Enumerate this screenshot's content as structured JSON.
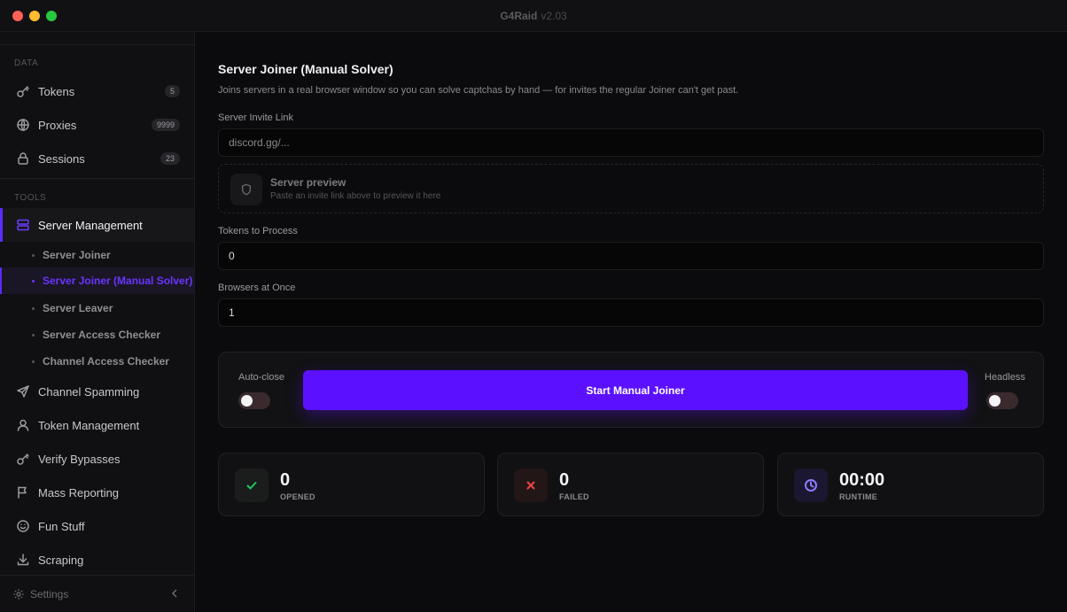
{
  "app": {
    "title": "G4Raid",
    "version": "v2.03"
  },
  "sidebar": {
    "sections": {
      "data": "DATA",
      "tools": "TOOLS"
    },
    "data_items": [
      {
        "label": "Tokens",
        "badge": "5",
        "icon": "key-icon"
      },
      {
        "label": "Proxies",
        "badge": "9999",
        "icon": "globe-icon"
      },
      {
        "label": "Sessions",
        "badge": "23",
        "icon": "lock-icon"
      }
    ],
    "active_item": {
      "label": "Server Management",
      "icon": "server-icon"
    },
    "sub_items": [
      {
        "label": "Server Joiner"
      },
      {
        "label": "Server Joiner (Manual Solver)"
      },
      {
        "label": "Server Leaver"
      },
      {
        "label": "Server Access Checker"
      },
      {
        "label": "Channel Access Checker"
      }
    ],
    "tool_items": [
      {
        "label": "Channel Spamming",
        "icon": "send-icon"
      },
      {
        "label": "Token Management",
        "icon": "user-icon"
      },
      {
        "label": "Verify Bypasses",
        "icon": "key-icon"
      },
      {
        "label": "Mass Reporting",
        "icon": "flag-icon"
      },
      {
        "label": "Fun Stuff",
        "icon": "smile-icon"
      },
      {
        "label": "Scraping",
        "icon": "download-icon"
      }
    ],
    "footer": {
      "label": "Settings",
      "icon": "gear-icon"
    }
  },
  "main": {
    "title": "Server Joiner (Manual Solver)",
    "description": "Joins servers in a real browser window so you can solve captchas by hand — for invites the regular Joiner can't get past.",
    "invite": {
      "label": "Server Invite Link",
      "placeholder": "discord.gg/..."
    },
    "preview": {
      "title": "Server preview",
      "subtitle": "Paste an invite link above to preview it here"
    },
    "tokens": {
      "label": "Tokens to Process",
      "value": "0"
    },
    "browsers": {
      "label": "Browsers at Once",
      "value": "1"
    },
    "auto_close": {
      "label": "Auto-close",
      "on": false
    },
    "headless": {
      "label": "Headless",
      "on": false
    },
    "start_button": "Start Manual Joiner",
    "stats": [
      {
        "value": "0",
        "label": "OPENED",
        "icon": "check-icon",
        "color": "#22c55e"
      },
      {
        "value": "0",
        "label": "FAILED",
        "icon": "x-icon",
        "color": "#ef4444"
      },
      {
        "value": "00:00",
        "label": "RUNTIME",
        "icon": "clock-icon",
        "color": "#7c5cff"
      }
    ]
  },
  "colors": {
    "accent": "#5b11ff",
    "background": "#0b0b0d"
  }
}
